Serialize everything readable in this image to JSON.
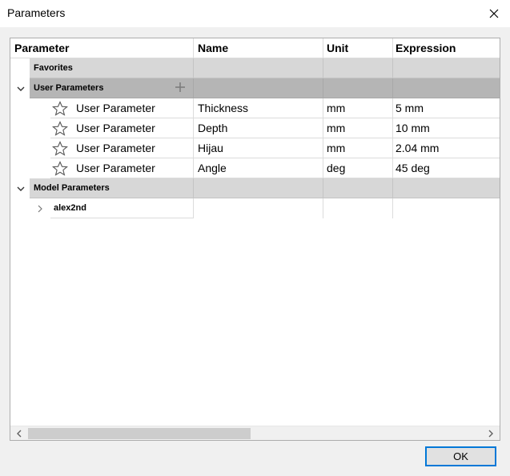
{
  "window": {
    "title": "Parameters"
  },
  "table": {
    "headers": {
      "parameter": "Parameter",
      "name": "Name",
      "unit": "Unit",
      "expression": "Expression"
    },
    "groups": {
      "favorites": "Favorites",
      "user_parameters": "User Parameters",
      "model_parameters": "Model Parameters"
    },
    "user_rows": [
      {
        "parameter": "User Parameter",
        "name": "Thickness",
        "unit": "mm",
        "expression": "5 mm"
      },
      {
        "parameter": "User Parameter",
        "name": "Depth",
        "unit": "mm",
        "expression": "10 mm"
      },
      {
        "parameter": "User Parameter",
        "name": "Hijau",
        "unit": "mm",
        "expression": "2.04 mm"
      },
      {
        "parameter": "User Parameter",
        "name": "Angle",
        "unit": "deg",
        "expression": "45 deg"
      }
    ],
    "model_rows": [
      {
        "parameter": "alex2nd"
      }
    ]
  },
  "icons": {
    "close": "close-icon",
    "star": "star-outline-icon",
    "plus": "plus-icon",
    "expand": "chevron-down-icon",
    "collapsed": "chevron-right-icon"
  },
  "buttons": {
    "ok": "OK"
  }
}
